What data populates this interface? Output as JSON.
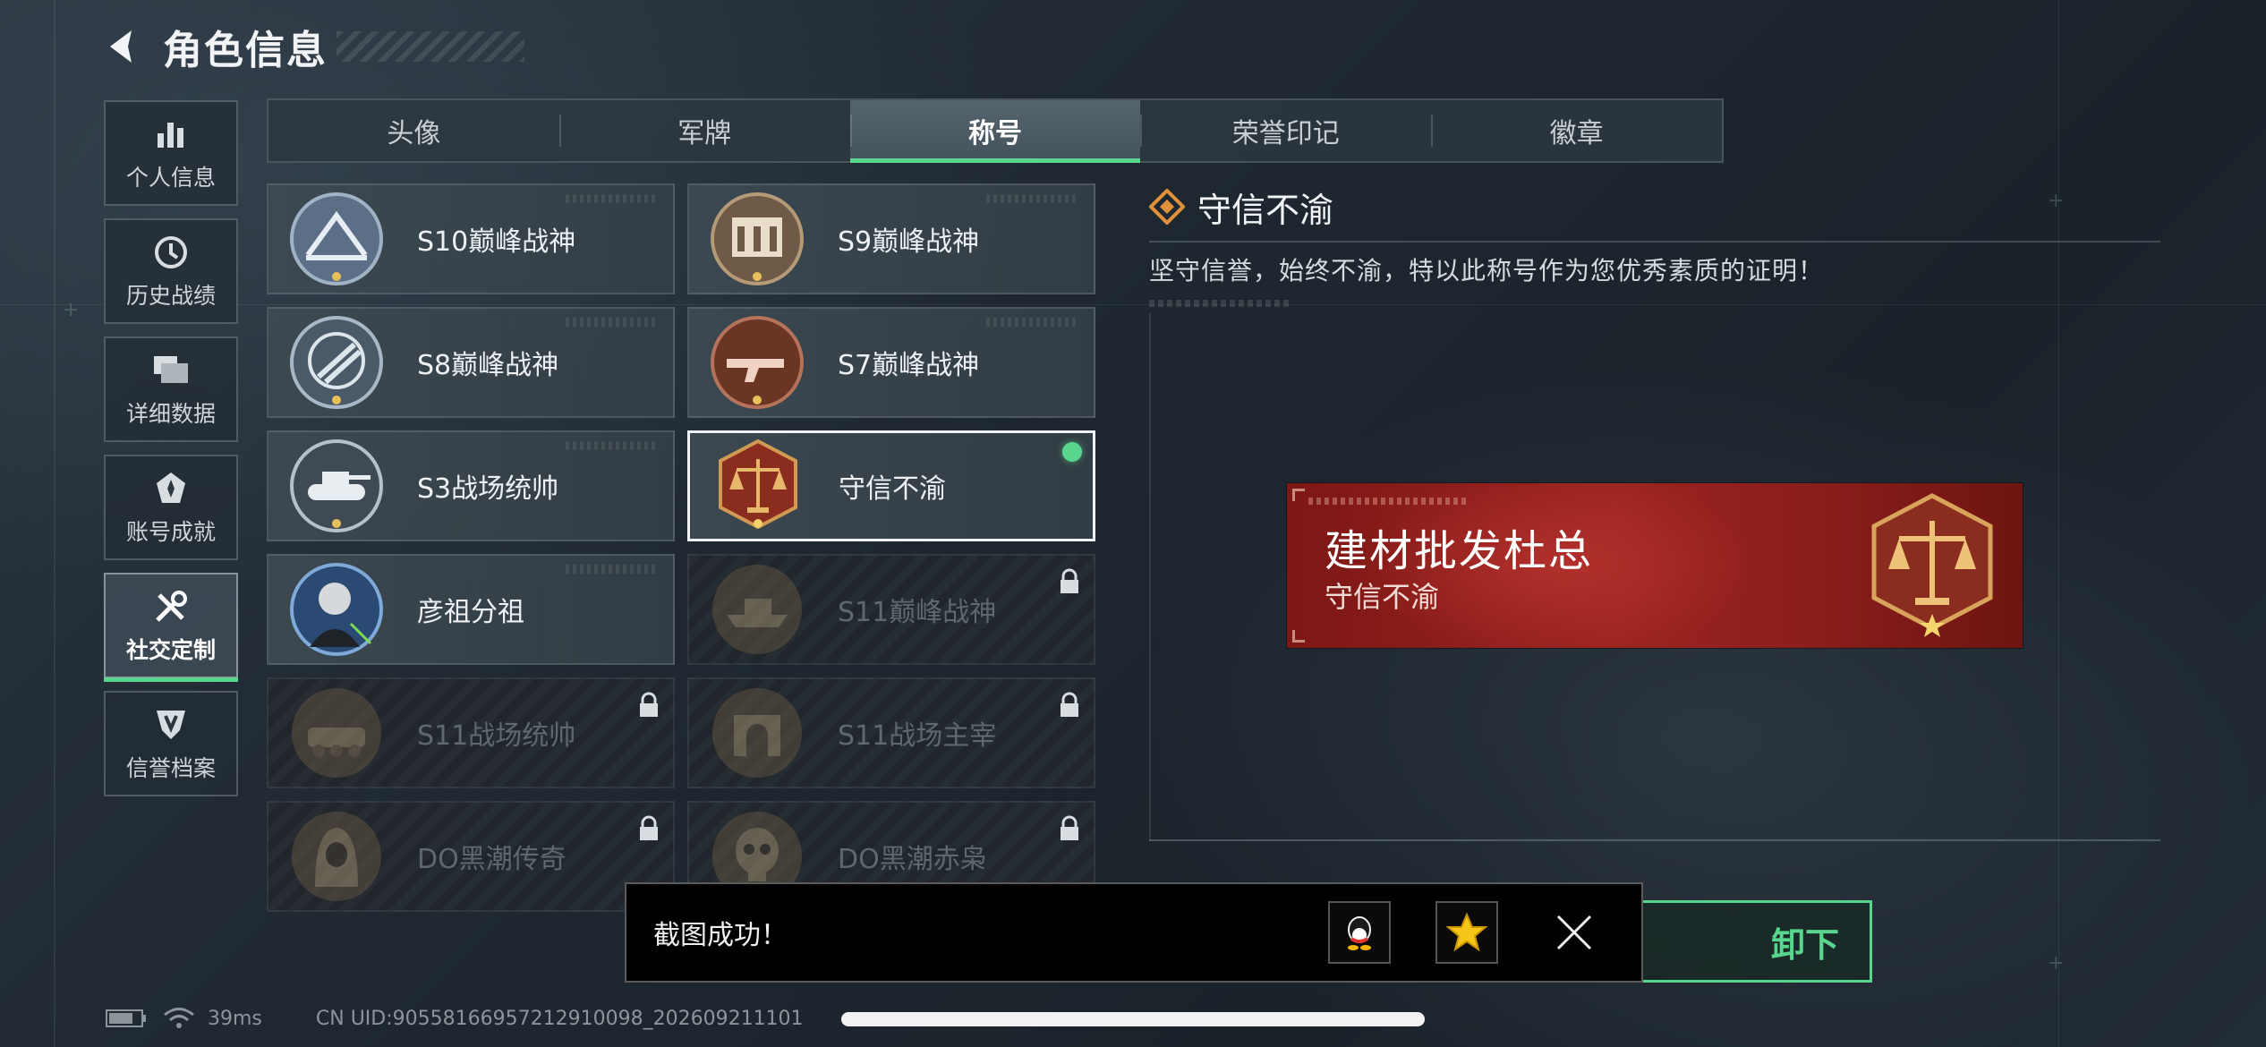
{
  "header": {
    "title": "角色信息"
  },
  "sidebar": {
    "items": [
      {
        "label": "个人信息",
        "icon": "bar-chart-icon"
      },
      {
        "label": "历史战绩",
        "icon": "clock-icon"
      },
      {
        "label": "详细数据",
        "icon": "folders-icon"
      },
      {
        "label": "账号成就",
        "icon": "medal-icon"
      },
      {
        "label": "社交定制",
        "icon": "tools-icon",
        "active": true
      },
      {
        "label": "信誉档案",
        "icon": "shield-icon"
      }
    ]
  },
  "tabs": [
    {
      "label": "头像"
    },
    {
      "label": "军牌"
    },
    {
      "label": "称号",
      "active": true
    },
    {
      "label": "荣誉印记"
    },
    {
      "label": "徽章"
    }
  ],
  "titles": [
    {
      "name": "S10巅峰战神",
      "icon": "bridge-emblem-icon",
      "locked": false
    },
    {
      "name": "S9巅峰战神",
      "icon": "building-emblem-icon",
      "locked": false
    },
    {
      "name": "S8巅峰战神",
      "icon": "slash-emblem-icon",
      "locked": false
    },
    {
      "name": "S7巅峰战神",
      "icon": "gun-emblem-icon",
      "locked": false
    },
    {
      "name": "S3战场统帅",
      "icon": "tank-emblem-icon",
      "locked": false
    },
    {
      "name": "守信不渝",
      "icon": "scales-emblem-icon",
      "locked": false,
      "selected": true
    },
    {
      "name": "彦祖分祖",
      "icon": "portrait-emblem-icon",
      "locked": false
    },
    {
      "name": "S11巅峰战神",
      "icon": "ship-emblem-icon",
      "locked": true
    },
    {
      "name": "S11战场统帅",
      "icon": "vehicle-emblem-icon",
      "locked": true
    },
    {
      "name": "S11战场主宰",
      "icon": "arch-emblem-icon",
      "locked": true
    },
    {
      "name": "DO黑潮传奇",
      "icon": "hooded-emblem-icon",
      "locked": true
    },
    {
      "name": "DO黑潮赤枭",
      "icon": "skull-emblem-icon",
      "locked": true
    }
  ],
  "detail": {
    "title": "守信不渝",
    "description": "坚守信誉，始终不渝，特以此称号作为您优秀素质的证明！"
  },
  "banner": {
    "name": "建材批发杜总",
    "title": "守信不渝"
  },
  "action": {
    "label_visible": "卸下"
  },
  "toast": {
    "message": "截图成功！"
  },
  "status": {
    "ping": "39ms",
    "uid": "CN UID:90558166957212910098_202609211101"
  },
  "colors": {
    "accent": "#58d68d",
    "banner_red": "#9b2420",
    "gold": "#c9a04a"
  }
}
